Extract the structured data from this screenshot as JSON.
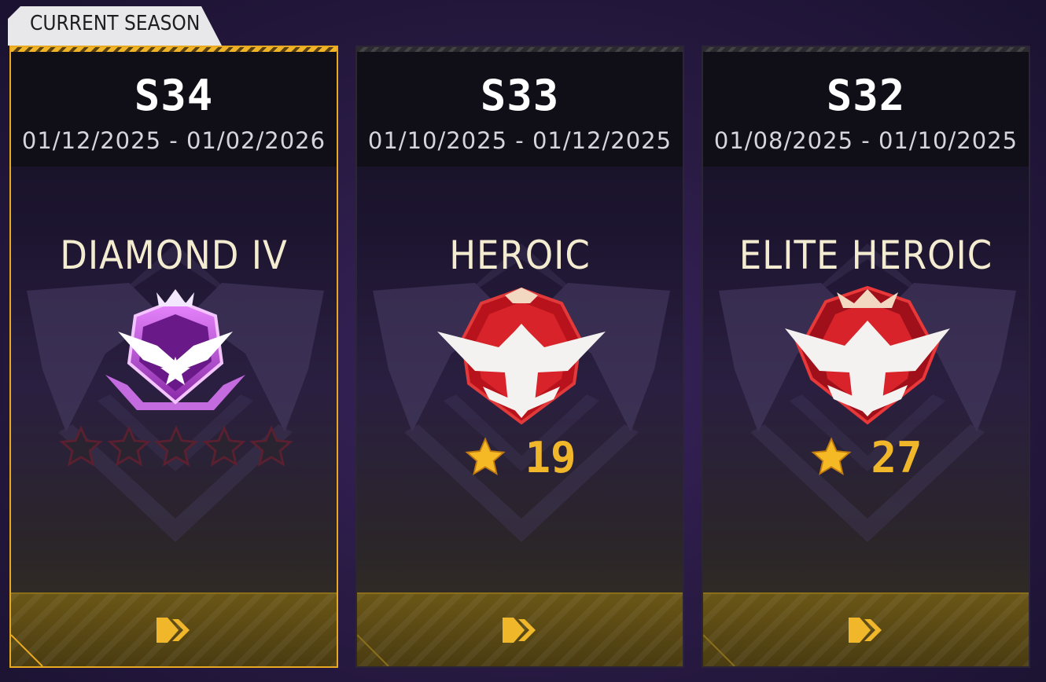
{
  "badge_label": "CURRENT SEASON",
  "colors": {
    "accent_gold": "#f0b72a",
    "current_border": "#e8a920",
    "diamond_purple": "#c254e8",
    "heroic_red": "#d8232a"
  },
  "seasons": [
    {
      "season": "S34",
      "dates": "01/12/2025 - 01/02/2026",
      "rank": "DIAMOND IV",
      "rank_icon": "diamond-rank-icon",
      "stars_earned": 0,
      "stars_total": 5,
      "current": true
    },
    {
      "season": "S33",
      "dates": "01/10/2025 - 01/12/2025",
      "rank": "HEROIC",
      "rank_icon": "heroic-rank-icon",
      "points": "19",
      "current": false
    },
    {
      "season": "S32",
      "dates": "01/08/2025 - 01/10/2025",
      "rank": "ELITE HEROIC",
      "rank_icon": "elite-heroic-rank-icon",
      "points": "27",
      "current": false
    }
  ],
  "footer_icon": "double-chevron-right-icon"
}
